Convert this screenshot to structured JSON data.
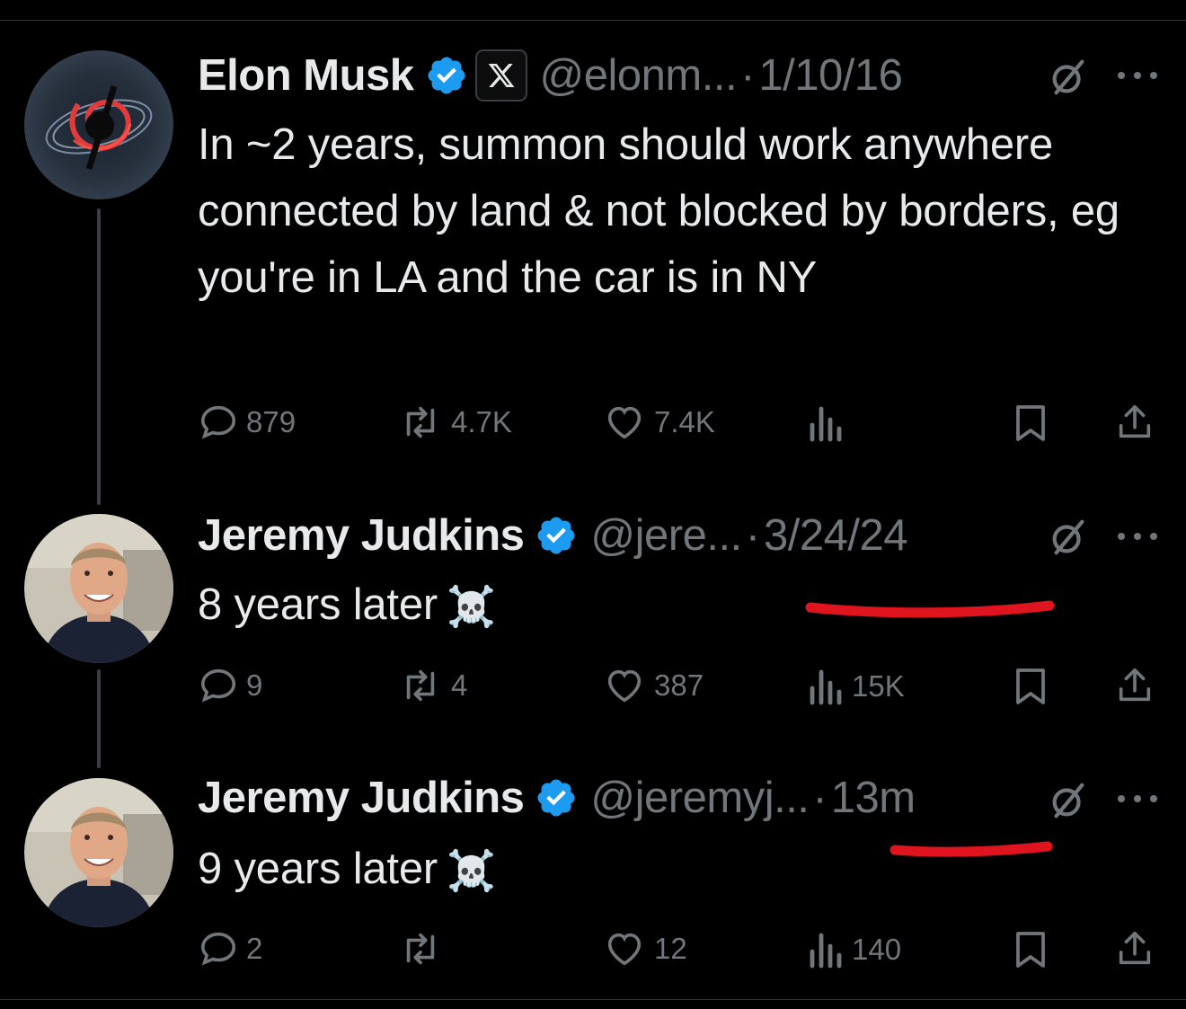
{
  "tweets": [
    {
      "name": "Elon Musk",
      "handle": "@elonm...",
      "time": "1/10/16",
      "text": "In ~2 years, summon should work anywhere connected by land & not blocked by borders, eg you're in LA and the car is in NY",
      "replies": "879",
      "reposts": "4.7K",
      "likes": "7.4K",
      "views": ""
    },
    {
      "name": "Jeremy Judkins",
      "handle": "@jere...",
      "time": "3/24/24",
      "text": "8 years later",
      "emoji": "☠️",
      "replies": "9",
      "reposts": "4",
      "likes": "387",
      "views": "15K"
    },
    {
      "name": "Jeremy Judkins",
      "handle": "@jeremyj...",
      "time": "13m",
      "text": "9 years later",
      "emoji": "☠️",
      "replies": "2",
      "reposts": "",
      "likes": "12",
      "views": "140"
    }
  ],
  "separator": "·",
  "colors": {
    "background": "#000000",
    "text": "#e7e9ea",
    "muted": "#71767b",
    "verified": "#1d9bf0",
    "annotation": "#e0141e"
  },
  "icons": [
    "verified-badge-icon",
    "x-logo-icon",
    "grok-icon",
    "more-icon",
    "reply-icon",
    "repost-icon",
    "like-icon",
    "views-icon",
    "bookmark-icon",
    "share-icon"
  ]
}
